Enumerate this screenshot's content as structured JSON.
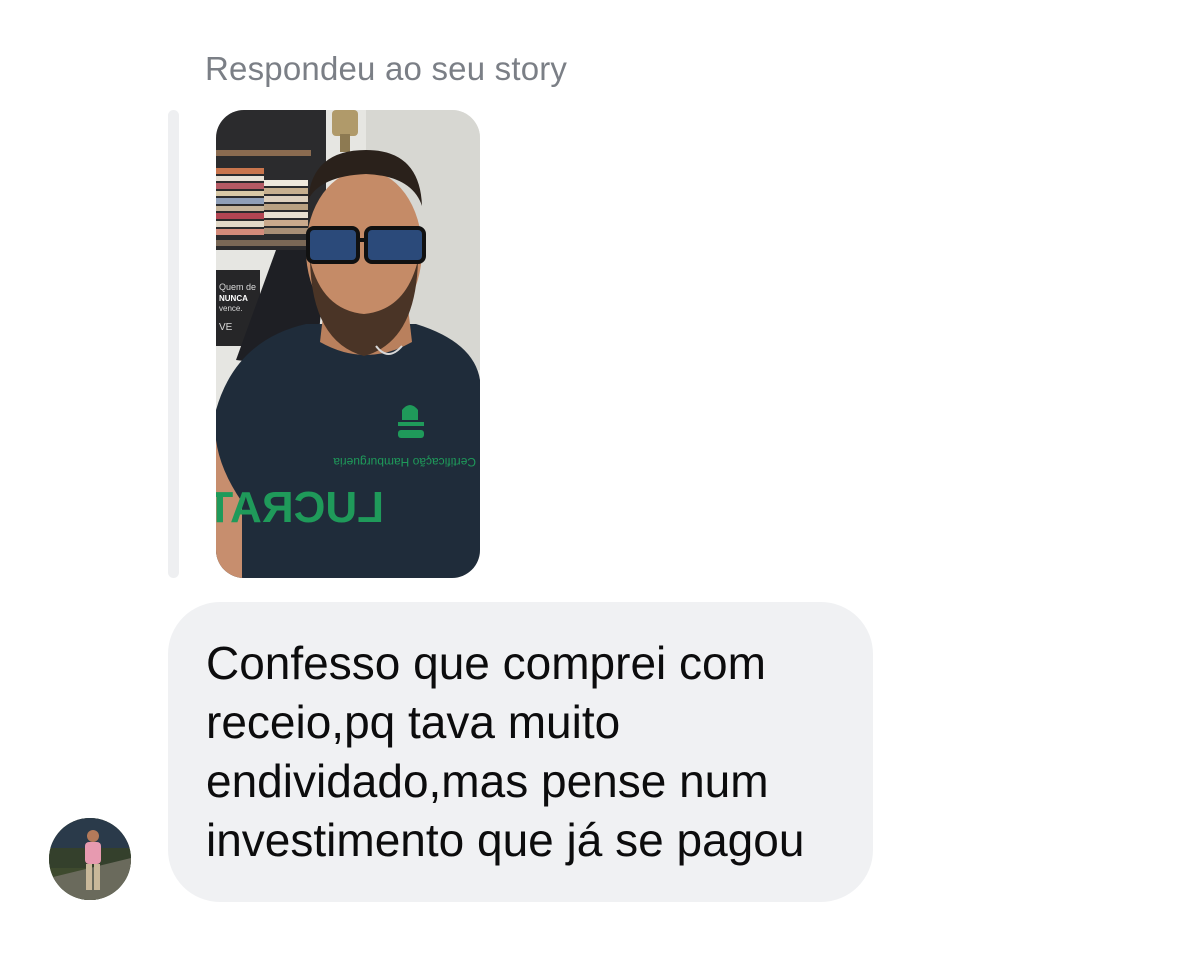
{
  "reply_context": {
    "label": "Respondeu ao seu story",
    "story_image": {
      "kind": "story-thumbnail",
      "shirt_print_top": "Certificação Hamburgueria",
      "shirt_print_main": "LUCRATIVA",
      "poster_text": [
        "Quem de",
        "NUNCA",
        "vence.",
        "VE"
      ]
    }
  },
  "message": {
    "lines": [
      "Confesso que comprei com",
      "receio,pq tava muito",
      "endividado,mas pense num",
      "investimento que já se pagou"
    ]
  },
  "sender": {
    "avatar": "profile-photo"
  },
  "colors": {
    "bubble_bg": "#f0f1f3",
    "label": "#7b7f86",
    "text": "#0c0c0d",
    "shirt": "#1f2c3a",
    "print_green": "#1f9a5a"
  }
}
